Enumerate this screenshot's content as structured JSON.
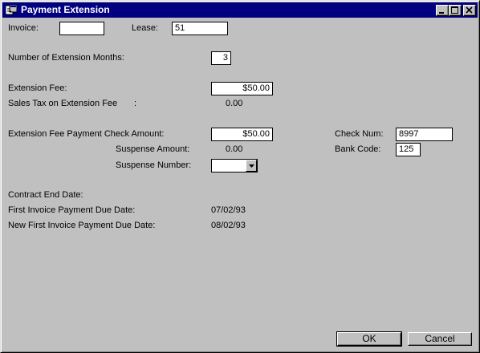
{
  "window": {
    "title": "Payment Extension"
  },
  "titlebar_buttons": {
    "minimize": "minimize-icon",
    "maximize": "maximize-icon",
    "close": "close-icon"
  },
  "form": {
    "invoice_label": "Invoice:",
    "invoice_value": "",
    "lease_label": "Lease:",
    "lease_value": "51",
    "ext_months_label": "Number of Extension Months:",
    "ext_months_value": "3",
    "ext_fee_label": "Extension Fee:",
    "ext_fee_value": "$50.00",
    "sales_tax_label": "Sales Tax on Extension Fee",
    "sales_tax_colon": ":",
    "sales_tax_value": "0.00",
    "check_amount_label": "Extension Fee Payment Check Amount:",
    "check_amount_value": "$50.00",
    "suspense_amount_label": "Suspense Amount:",
    "suspense_amount_value": "0.00",
    "suspense_number_label": "Suspense Number:",
    "suspense_number_value": "",
    "check_num_label": "Check Num:",
    "check_num_value": "8997",
    "bank_code_label": "Bank Code:",
    "bank_code_value": "125",
    "contract_end_label": "Contract End Date:",
    "contract_end_value": "",
    "first_due_label": "First Invoice Payment Due Date:",
    "first_due_value": "07/02/93",
    "new_first_due_label": "New First Invoice Payment Due Date:",
    "new_first_due_value": "08/02/93"
  },
  "buttons": {
    "ok": "OK",
    "cancel": "Cancel"
  },
  "colors": {
    "titlebar": "#000080",
    "face": "#c0c0c0"
  }
}
